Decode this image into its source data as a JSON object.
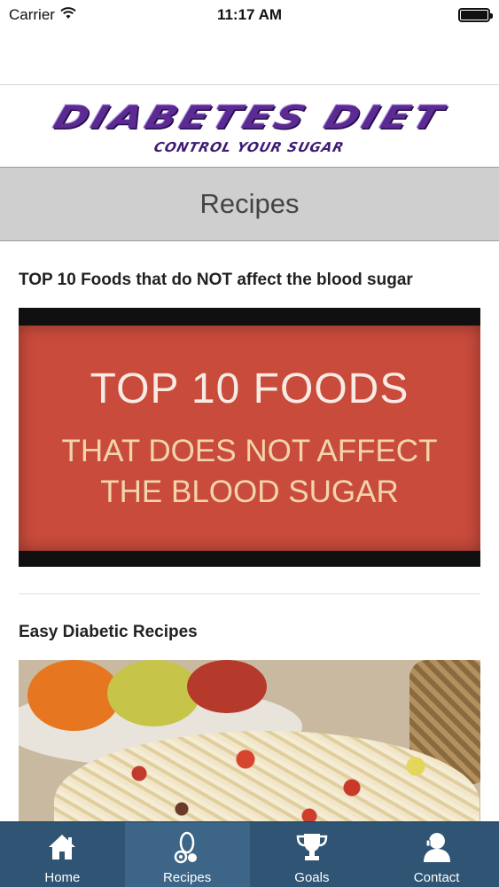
{
  "status_bar": {
    "carrier": "Carrier",
    "time": "11:17 AM",
    "battery_level": 1.0
  },
  "header": {
    "logo_title": "DIABETES DIET",
    "logo_subtitle": "CONTROL YOUR SUGAR",
    "page_title": "Recipes"
  },
  "recipes": [
    {
      "title": "TOP 10 Foods that do NOT affect the blood sugar",
      "thumbnail_text": {
        "line1": "TOP 10 FOODS",
        "line2": "THAT DOES NOT AFFECT",
        "line3": "THE BLOOD SUGAR"
      }
    },
    {
      "title": "Easy Diabetic Recipes"
    }
  ],
  "tab_bar": {
    "tabs": [
      {
        "label": "Home",
        "icon": "home-icon"
      },
      {
        "label": "Recipes",
        "icon": "recipes-icon",
        "active": true
      },
      {
        "label": "Goals",
        "icon": "trophy-icon"
      },
      {
        "label": "Contact",
        "icon": "contact-icon"
      }
    ]
  },
  "colors": {
    "tab_bar_bg": "#2f5474",
    "tab_active_bg": "#3c6587",
    "title_bar_bg": "#cfcfcf",
    "thumbnail_red": "#c94b3c",
    "logo_purple": "#5b2a93"
  }
}
